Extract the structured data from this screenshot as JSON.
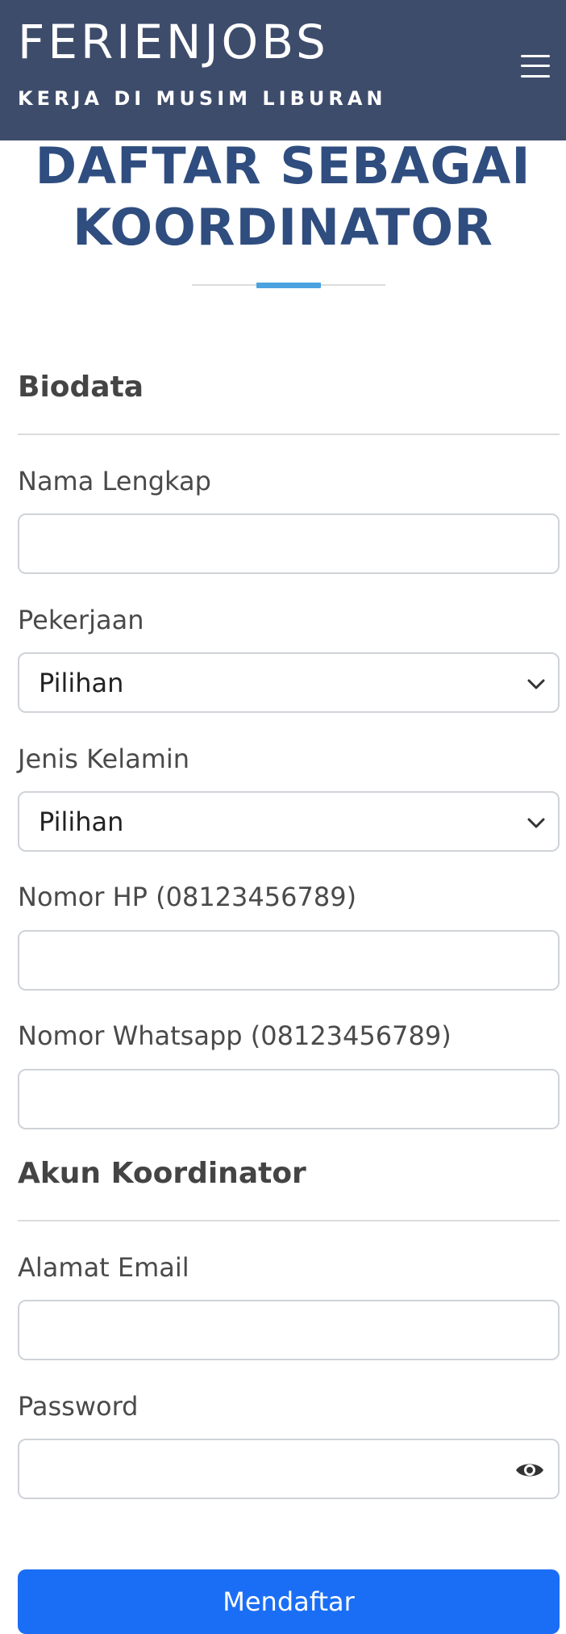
{
  "header": {
    "brand": "FERIENJOBS",
    "tagline": "KERJA DI MUSIM LIBURAN",
    "menu_icon": "hamburger-menu-icon",
    "background_color": "#3e4c6b"
  },
  "page_title": {
    "line1": "DAFTAR SEBAGAI",
    "line2": "KOORDINATOR",
    "color": "#2f4d7f",
    "accent_color": "#4aa3df"
  },
  "form": {
    "biodata": {
      "heading": "Biodata",
      "full_name": {
        "label": "Nama Lengkap",
        "value": "",
        "placeholder": ""
      },
      "occupation": {
        "label": "Pekerjaan",
        "selected": "Pilihan"
      },
      "gender": {
        "label": "Jenis Kelamin",
        "selected": "Pilihan"
      },
      "phone": {
        "label": "Nomor HP (08123456789)",
        "value": "",
        "placeholder": ""
      },
      "whatsapp": {
        "label": "Nomor Whatsapp (08123456789)",
        "value": "",
        "placeholder": ""
      }
    },
    "account": {
      "heading": "Akun Koordinator",
      "email": {
        "label": "Alamat Email",
        "value": "",
        "placeholder": ""
      },
      "password": {
        "label": "Password",
        "value": "",
        "placeholder": "",
        "toggle_icon": "eye-icon"
      }
    },
    "submit_label": "Mendaftar",
    "submit_color": "#1a6ef5"
  }
}
